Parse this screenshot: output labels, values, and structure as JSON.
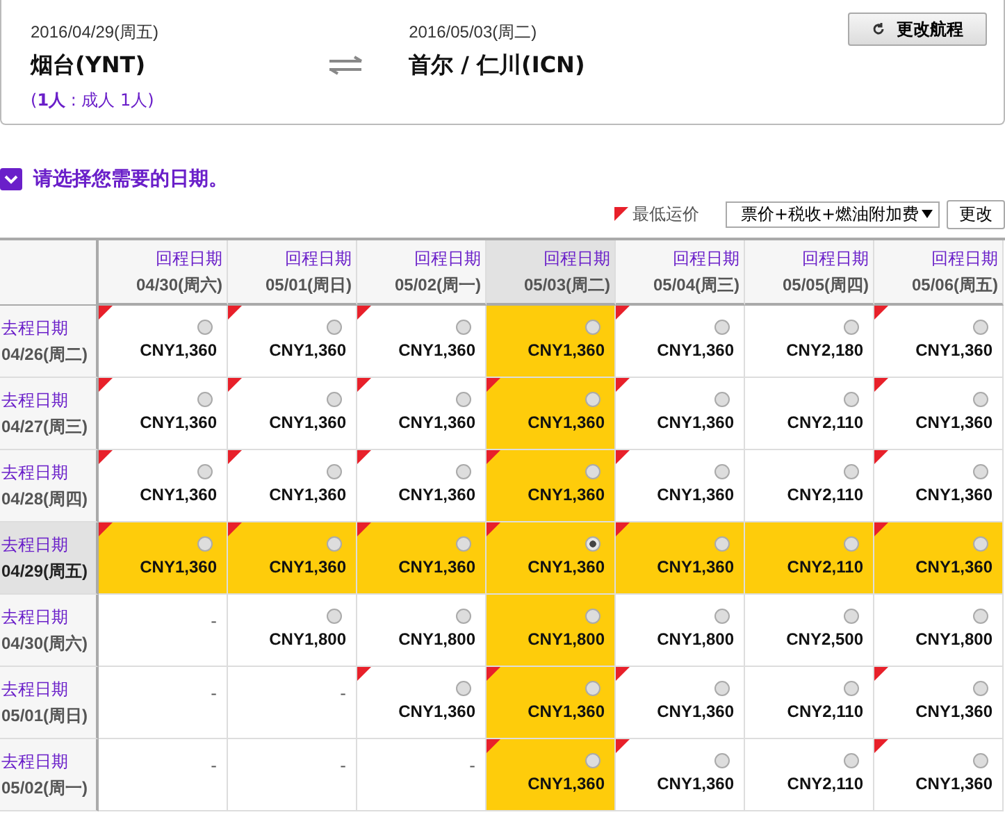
{
  "itinerary": {
    "depart_date": "2016/04/29(周五)",
    "origin": "烟台(YNT)",
    "return_date": "2016/05/03(周二)",
    "destination": "首尔 / 仁川(ICN)",
    "passengers": "(**1人** : 成人 1人)",
    "change_button": "更改航程"
  },
  "section_title": "请选择您需要的日期。",
  "legend": "最低运价",
  "fare_select": {
    "value": "票价+税收+燃油附加费"
  },
  "update_button": "更改",
  "columns": [
    {
      "label": "回程日期",
      "date": "04/30(周六)",
      "selected": false
    },
    {
      "label": "回程日期",
      "date": "05/01(周日)",
      "selected": false
    },
    {
      "label": "回程日期",
      "date": "05/02(周一)",
      "selected": false
    },
    {
      "label": "回程日期",
      "date": "05/03(周二)",
      "selected": true
    },
    {
      "label": "回程日期",
      "date": "05/04(周三)",
      "selected": false
    },
    {
      "label": "回程日期",
      "date": "05/05(周四)",
      "selected": false
    },
    {
      "label": "回程日期",
      "date": "05/06(周五)",
      "selected": false
    }
  ],
  "rows": [
    {
      "label": "去程日期",
      "date": "04/26(周二)",
      "selected": false,
      "cells": [
        {
          "price": "CNY1,360",
          "lowest": true,
          "selected": false
        },
        {
          "price": "CNY1,360",
          "lowest": true,
          "selected": false
        },
        {
          "price": "CNY1,360",
          "lowest": true,
          "selected": false
        },
        {
          "price": "CNY1,360",
          "lowest": false,
          "selected": false
        },
        {
          "price": "CNY1,360",
          "lowest": true,
          "selected": false
        },
        {
          "price": "CNY2,180",
          "lowest": false,
          "selected": false
        },
        {
          "price": "CNY1,360",
          "lowest": true,
          "selected": false
        }
      ]
    },
    {
      "label": "去程日期",
      "date": "04/27(周三)",
      "selected": false,
      "cells": [
        {
          "price": "CNY1,360",
          "lowest": true,
          "selected": false
        },
        {
          "price": "CNY1,360",
          "lowest": true,
          "selected": false
        },
        {
          "price": "CNY1,360",
          "lowest": true,
          "selected": false
        },
        {
          "price": "CNY1,360",
          "lowest": true,
          "selected": false
        },
        {
          "price": "CNY1,360",
          "lowest": true,
          "selected": false
        },
        {
          "price": "CNY2,110",
          "lowest": false,
          "selected": false
        },
        {
          "price": "CNY1,360",
          "lowest": true,
          "selected": false
        }
      ]
    },
    {
      "label": "去程日期",
      "date": "04/28(周四)",
      "selected": false,
      "cells": [
        {
          "price": "CNY1,360",
          "lowest": true,
          "selected": false
        },
        {
          "price": "CNY1,360",
          "lowest": true,
          "selected": false
        },
        {
          "price": "CNY1,360",
          "lowest": true,
          "selected": false
        },
        {
          "price": "CNY1,360",
          "lowest": true,
          "selected": false
        },
        {
          "price": "CNY1,360",
          "lowest": true,
          "selected": false
        },
        {
          "price": "CNY2,110",
          "lowest": false,
          "selected": false
        },
        {
          "price": "CNY1,360",
          "lowest": true,
          "selected": false
        }
      ]
    },
    {
      "label": "去程日期",
      "date": "04/29(周五)",
      "selected": true,
      "cells": [
        {
          "price": "CNY1,360",
          "lowest": true,
          "selected": false
        },
        {
          "price": "CNY1,360",
          "lowest": true,
          "selected": false
        },
        {
          "price": "CNY1,360",
          "lowest": true,
          "selected": false
        },
        {
          "price": "CNY1,360",
          "lowest": true,
          "selected": true
        },
        {
          "price": "CNY1,360",
          "lowest": true,
          "selected": false
        },
        {
          "price": "CNY2,110",
          "lowest": false,
          "selected": false
        },
        {
          "price": "CNY1,360",
          "lowest": true,
          "selected": false
        }
      ]
    },
    {
      "label": "去程日期",
      "date": "04/30(周六)",
      "selected": false,
      "cells": [
        {
          "price": "-",
          "lowest": false
        },
        {
          "price": "CNY1,800",
          "lowest": false,
          "selected": false
        },
        {
          "price": "CNY1,800",
          "lowest": false,
          "selected": false
        },
        {
          "price": "CNY1,800",
          "lowest": false,
          "selected": false
        },
        {
          "price": "CNY1,800",
          "lowest": false,
          "selected": false
        },
        {
          "price": "CNY2,500",
          "lowest": false,
          "selected": false
        },
        {
          "price": "CNY1,800",
          "lowest": false,
          "selected": false
        }
      ]
    },
    {
      "label": "去程日期",
      "date": "05/01(周日)",
      "selected": false,
      "cells": [
        {
          "price": "-",
          "lowest": false
        },
        {
          "price": "-",
          "lowest": false
        },
        {
          "price": "CNY1,360",
          "lowest": true,
          "selected": false
        },
        {
          "price": "CNY1,360",
          "lowest": true,
          "selected": false
        },
        {
          "price": "CNY1,360",
          "lowest": true,
          "selected": false
        },
        {
          "price": "CNY2,110",
          "lowest": false,
          "selected": false
        },
        {
          "price": "CNY1,360",
          "lowest": true,
          "selected": false
        }
      ]
    },
    {
      "label": "去程日期",
      "date": "05/02(周一)",
      "selected": false,
      "cells": [
        {
          "price": "-",
          "lowest": false
        },
        {
          "price": "-",
          "lowest": false
        },
        {
          "price": "-",
          "lowest": false
        },
        {
          "price": "CNY1,360",
          "lowest": true,
          "selected": false
        },
        {
          "price": "CNY1,360",
          "lowest": true,
          "selected": false
        },
        {
          "price": "CNY2,110",
          "lowest": false,
          "selected": false
        },
        {
          "price": "CNY1,360",
          "lowest": true,
          "selected": false
        }
      ]
    }
  ]
}
